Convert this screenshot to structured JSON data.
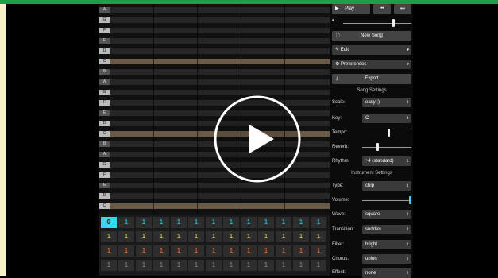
{
  "toolbar": {
    "play_label": "Play",
    "prev_icon": "skip-back-icon",
    "next_icon": "skip-forward-icon",
    "volume_icon": "speaker-icon",
    "volume_level": 0.75
  },
  "menu": {
    "new_song": "New Song",
    "edit": "Edit",
    "preferences": "Preferences",
    "export": "Export"
  },
  "song_settings": {
    "title": "Song Settings",
    "scale_label": "Scale:",
    "scale_value": "easy :)",
    "key_label": "Key:",
    "key_value": "C",
    "tempo_label": "Tempo:",
    "tempo_level": 0.55,
    "reverb_label": "Reverb:",
    "reverb_level": 0.3,
    "rhythm_label": "Rhythm:",
    "rhythm_value": "÷4 (standard)"
  },
  "instrument_settings": {
    "title": "Instrument Settings",
    "type_label": "Type:",
    "type_value": "chip",
    "volume_label": "Volume:",
    "volume_level": 1.0,
    "wave_label": "Wave:",
    "wave_value": "square",
    "transition_label": "Transition:",
    "transition_value": "sudden",
    "filter_label": "Filter:",
    "filter_value": "bright",
    "chorus_label": "Chorus:",
    "chorus_value": "union",
    "effect_label": "Effect:",
    "effect_value": "none"
  },
  "piano_keys": [
    "A",
    "G",
    "F",
    "E",
    "D",
    "C",
    "B",
    "A",
    "G",
    "F",
    "E",
    "D",
    "C",
    "B",
    "A",
    "G",
    "F",
    "E",
    "D",
    "C"
  ],
  "pattern": {
    "selected_value": "0",
    "cell_value": "1",
    "row_colors": [
      "#3ad6f0",
      "#e8e86a",
      "#ff7a3a",
      "#888888"
    ]
  },
  "colors": {
    "accent_green": "#1f9e4a",
    "highlight_row": "#6b5a47"
  }
}
